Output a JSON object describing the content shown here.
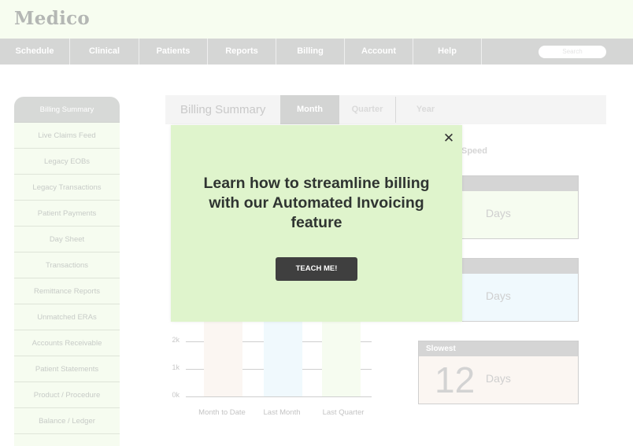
{
  "app": {
    "brand": "Medico"
  },
  "nav": {
    "items": [
      "Schedule",
      "Clinical",
      "Patients",
      "Reports",
      "Billing",
      "Account",
      "Help"
    ],
    "search_placeholder": "Search"
  },
  "sidebar": {
    "items": [
      "Billing Summary",
      "Live Claims Feed",
      "Legacy EOBs",
      "Legacy Transactions",
      "Patient Payments",
      "Day Sheet",
      "Transactions",
      "Remittance Reports",
      "Unmatched ERAs",
      "Accounts Receivable",
      "Patient Statements",
      "Product / Procedure",
      "Balance / Ledger"
    ],
    "active_index": 0
  },
  "tabs": {
    "title": "Billing Summary",
    "items": [
      "Month",
      "Quarter",
      "Year"
    ],
    "active": "Month"
  },
  "speed": {
    "label_visible": "Speed",
    "cards": [
      {
        "title": "",
        "value": "",
        "unit": "Days",
        "color": "#f6fcf0"
      },
      {
        "title": "",
        "value": "",
        "unit": "Days",
        "color": "#f0f9fd"
      },
      {
        "title": "Slowest",
        "value": "12",
        "unit": "Days",
        "color": "#fbf6f2"
      }
    ]
  },
  "chart_data": {
    "type": "bar",
    "categories": [
      "Month to Date",
      "Last Month",
      "Last Quarter"
    ],
    "tick_labels": [
      "2k",
      "1k",
      "0k"
    ],
    "colors": [
      "#fbf6f2",
      "#f0f9fd",
      "#f6fcf0"
    ]
  },
  "modal": {
    "title": "Learn how to streamline billing with our Automated Invoicing feature",
    "button": "TEACH ME!",
    "close_symbol": "✕"
  }
}
